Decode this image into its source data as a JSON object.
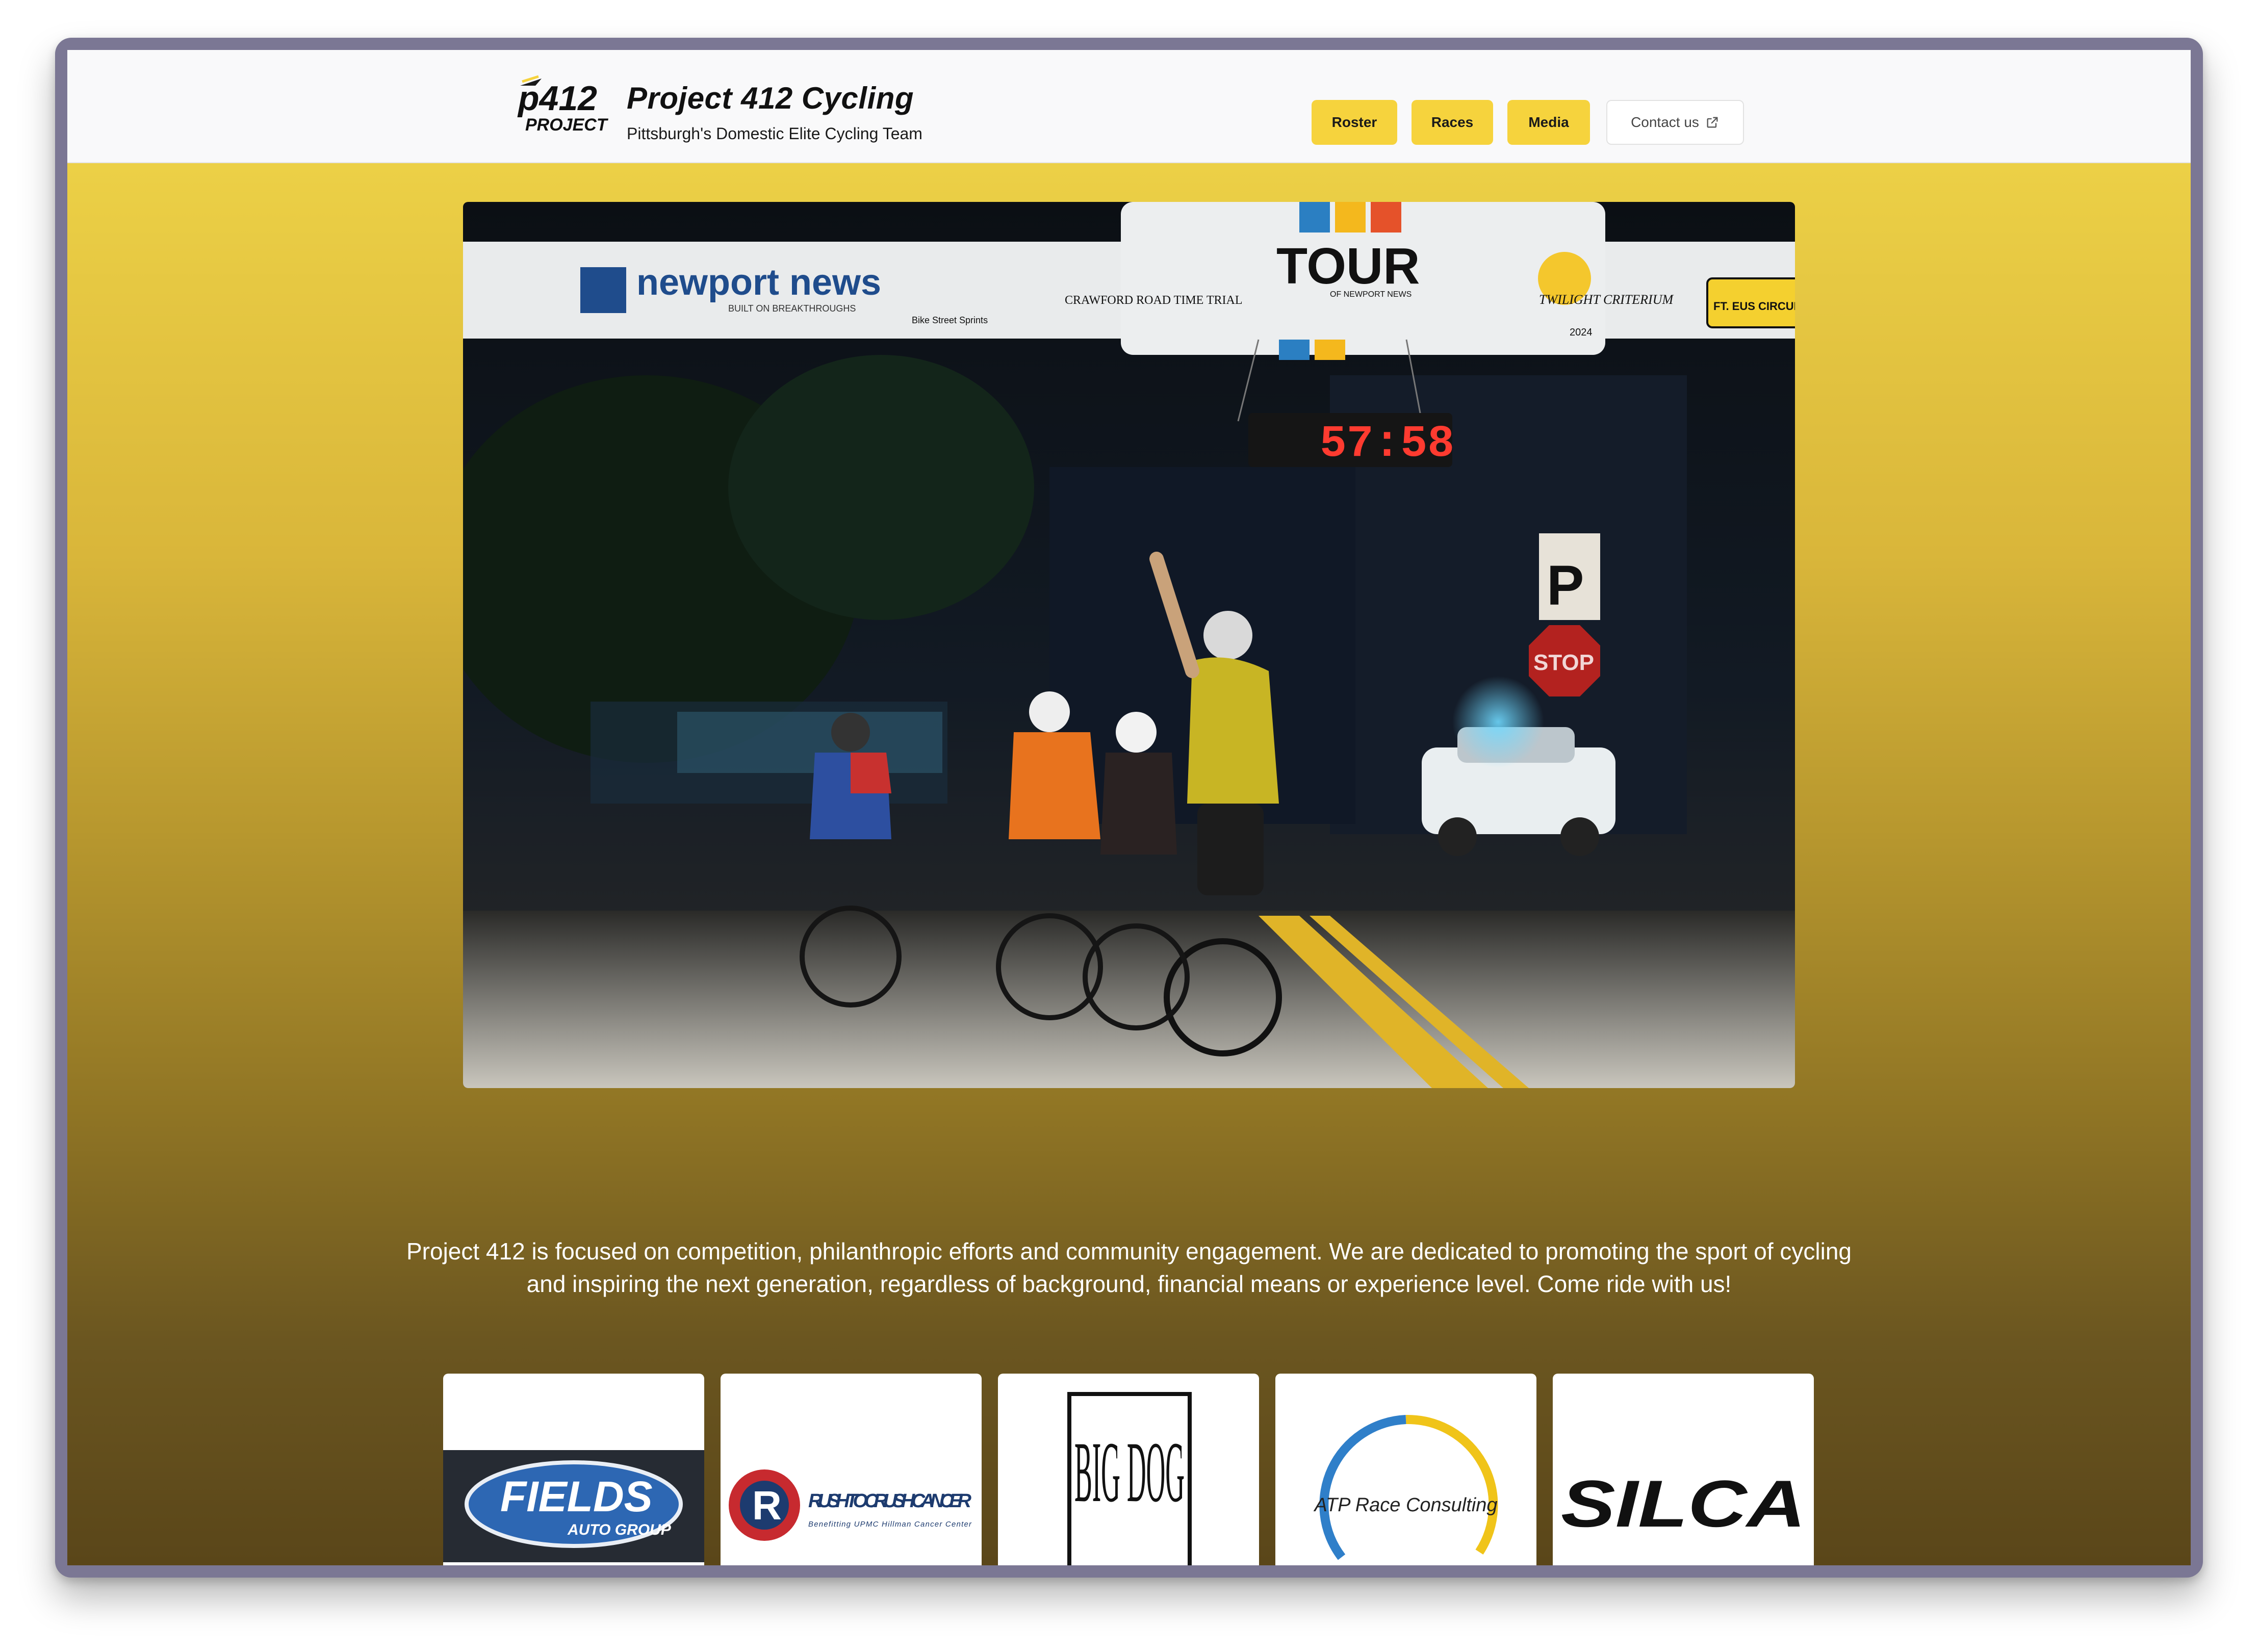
{
  "header": {
    "logo_text": "P412 PROJECT",
    "title": "Project 412 Cycling",
    "tagline": "Pittsburgh's Domestic Elite Cycling Team"
  },
  "nav": {
    "items": [
      {
        "label": "Roster"
      },
      {
        "label": "Races"
      },
      {
        "label": "Media"
      }
    ],
    "contact_label": "Contact us",
    "contact_icon": "external-link-icon"
  },
  "hero": {
    "banner_sponsors": [
      "newport news",
      "BUILT ON BREAKTHROUGHS",
      "Bike Street Sprints",
      "CRAWFORD ROAD TIME TRIAL",
      "TOUR",
      "OF NEWPORT NEWS",
      "TWILIGHT CRITERIUM",
      "2024",
      "FT. EUS CIRCUIT"
    ],
    "clock": "57:58",
    "signs": [
      "P",
      "STOP"
    ]
  },
  "mission": {
    "text": "Project 412 is focused on competition, philanthropic efforts and community engagement. We are dedicated to promoting the sport of cycling and inspiring the next generation, regardless of background, financial means or experience level. Come ride with us!"
  },
  "sponsors": [
    {
      "name": "FIELDS",
      "sub": "AUTO GROUP"
    },
    {
      "name": "RUSH TO CRUSH CANCER",
      "sub": "Benefitting UPMC Hillman Cancer Center"
    },
    {
      "name": "BIG DOG"
    },
    {
      "name": "ATP Race Consulting"
    },
    {
      "name": "SILCA"
    }
  ],
  "colors": {
    "accent": "#f6d33d",
    "gradient_top": "#ecd046",
    "gradient_bottom": "#5a4619"
  }
}
